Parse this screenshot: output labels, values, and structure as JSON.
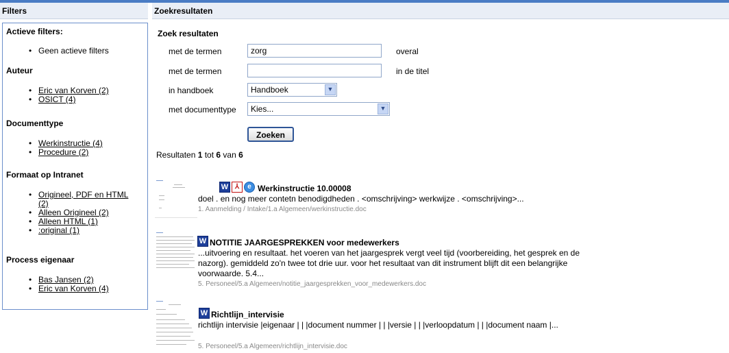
{
  "headers": {
    "filters": "Filters",
    "results": "Zoekresultaten"
  },
  "sidebar": {
    "active": {
      "title": "Actieve filters:",
      "items": [
        "Geen actieve filters"
      ]
    },
    "author": {
      "title": "Auteur",
      "items": [
        "Eric van Korven (2)",
        "OSICT (4)"
      ]
    },
    "doctype": {
      "title": "Documenttype",
      "items": [
        "Werkinstructie (4)",
        "Procedure (2)"
      ]
    },
    "format": {
      "title": "Formaat op Intranet",
      "items": [
        "Origineel, PDF en HTML",
        "(2)",
        "Alleen Origineel (2)",
        "Alleen HTML (1)",
        ":original (1)"
      ]
    },
    "owner": {
      "title": "Process eigenaar",
      "items": [
        "Bas Jansen (2)",
        "Eric van Korven (4)"
      ]
    }
  },
  "search": {
    "title": "Zoek resultaten",
    "terms_label": "met de termen",
    "terms_value": "zorg",
    "terms_scope": "overal",
    "title_terms_label": "met de termen",
    "title_terms_value": "",
    "title_scope": "in de titel",
    "handbook_label": "in handboek",
    "handbook_value": "Handboek",
    "doctype_label": "met documenttype",
    "doctype_value": "Kies...",
    "submit": "Zoeken"
  },
  "results_count": {
    "prefix": "Resultaten ",
    "from": "1",
    "mid": " tot ",
    "to": "6",
    "mid2": " van ",
    "total": "6"
  },
  "results": [
    {
      "title": "Werkinstructie 10.00008",
      "icons": [
        "word-icon",
        "pdf-icon",
        "html-icon"
      ],
      "snippet": "doel . en nog meer contetn benodigdheden . <omschrijving> werkwijze . <omschrijving>...",
      "path": "1. Aanmelding / Intake/1.a Algemeen/werkinstructie.doc"
    },
    {
      "title": "NOTITIE JAARGESPREKKEN voor medewerkers",
      "icons": [
        "word-icon"
      ],
      "snippet": "...uitvoering en resultaat. het voeren van het jaargesprek vergt veel tijd (voorbereiding, het gesprek en de nazorg). gemiddeld zo'n twee tot drie uur. voor het resultaat van dit instrument blijft dit een belangrijke voorwaarde. 5.4...",
      "path": "5. Personeel/5.a Algemeen/notitie_jaargesprekken_voor_medewerkers.doc"
    },
    {
      "title": "Richtlijn_intervisie",
      "icons": [
        "word-icon"
      ],
      "snippet": "richtlijn intervisie |eigenaar | | |document nummer | | |versie | | |verloopdatum | | |document naam |...",
      "path": "5. Personeel/5.a Algemeen/richtlijn_intervisie.doc"
    }
  ],
  "colors": {
    "accent": "#4a7cc4",
    "header_bg": "#e9eef6",
    "border": "#6a8ecb",
    "path": "#888888"
  }
}
